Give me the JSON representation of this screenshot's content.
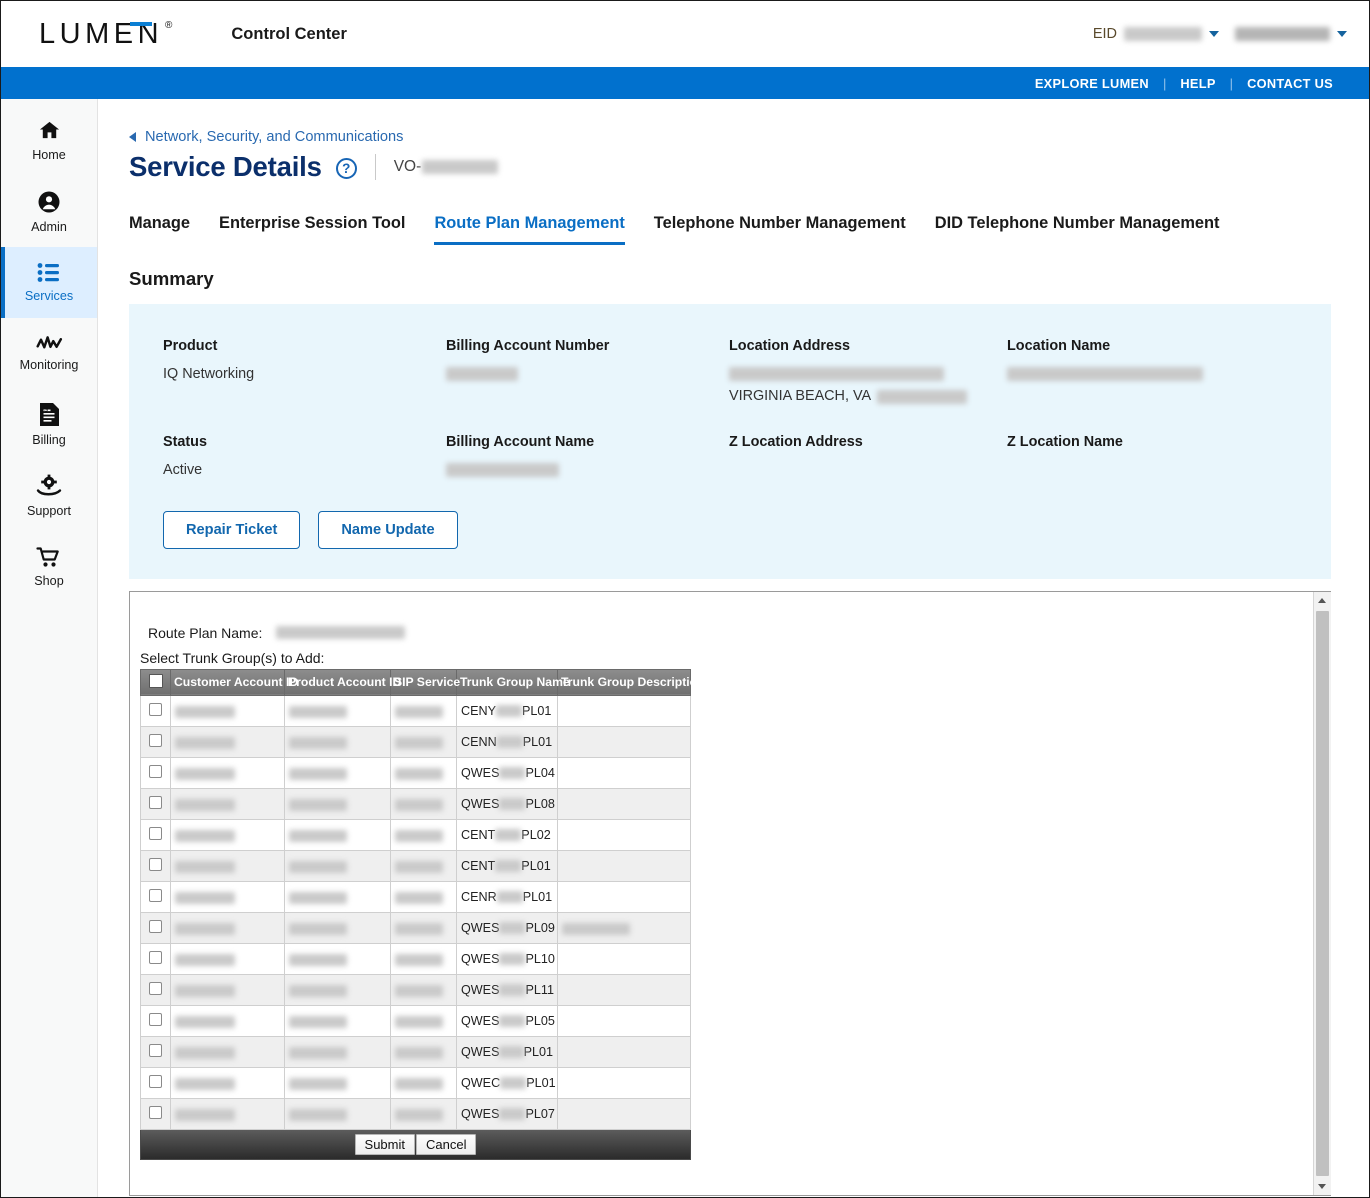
{
  "header": {
    "brand": "LUMEN",
    "brand_registered": "®",
    "app_title": "Control Center",
    "eid_label": "EID",
    "eid_value": "1111762722",
    "account_name": "thatfinancialdd"
  },
  "bluebar": {
    "explore": "EXPLORE LUMEN",
    "help": "HELP",
    "contact": "CONTACT US",
    "separator": "|"
  },
  "sidebar": {
    "items": [
      {
        "label": "Home",
        "icon": "home-icon",
        "active": false
      },
      {
        "label": "Admin",
        "icon": "user-circle-icon",
        "active": false
      },
      {
        "label": "Services",
        "icon": "list-icon",
        "active": true
      },
      {
        "label": "Monitoring",
        "icon": "activity-icon",
        "active": false
      },
      {
        "label": "Billing",
        "icon": "invoice-icon",
        "active": false
      },
      {
        "label": "Support",
        "icon": "support-gear-hand-icon",
        "active": false
      },
      {
        "label": "Shop",
        "icon": "cart-icon",
        "active": false
      }
    ]
  },
  "breadcrumb": {
    "label": "Network, Security, and Communications",
    "back_icon": "chevron-left-icon"
  },
  "page": {
    "title": "Service Details",
    "help_icon": "question-mark-icon",
    "service_id_prefix": "VO-",
    "service_id_value": "1002275aa"
  },
  "tabs": [
    {
      "label": "Manage",
      "active": false
    },
    {
      "label": "Enterprise Session Tool",
      "active": false
    },
    {
      "label": "Route Plan Management",
      "active": true
    },
    {
      "label": "Telephone Number Management",
      "active": false
    },
    {
      "label": "DID Telephone Number Management",
      "active": false
    }
  ],
  "summary": {
    "heading": "Summary",
    "fields": [
      {
        "label": "Product",
        "value": "IQ Networking",
        "redacted": false
      },
      {
        "label": "Billing Account Number",
        "value": "78362024",
        "redacted": true
      },
      {
        "label": "Location Address",
        "value_line1": "222 CENTRAL PARK AVE, FLR 16,",
        "value_line2_visible": "VIRGINIA BEACH, VA",
        "value_line2_redacted": "23462, USA",
        "redacted": true
      },
      {
        "label": "Location Name",
        "value": "VIRGINIA BEACH - NORFOLK",
        "redacted": true
      },
      {
        "label": "Status",
        "value": "Active",
        "redacted": false
      },
      {
        "label": "Billing Account Name",
        "value": "APEX SYSTEMS",
        "redacted": true
      },
      {
        "label": "Z Location Address",
        "value": "",
        "redacted": false
      },
      {
        "label": "Z Location Name",
        "value": "",
        "redacted": false
      }
    ],
    "buttons": [
      {
        "label": "Repair Ticket"
      },
      {
        "label": "Name Update"
      }
    ]
  },
  "route_plan": {
    "name_label": "Route Plan Name:",
    "name_value": "TRTE_QVHDWNUPL01",
    "select_label": "Select Trunk Group(s) to Add:",
    "columns": [
      "",
      "Customer Account ID",
      "Product Account ID",
      "SIP Service",
      "Trunk Group Name",
      "Trunk Group Description"
    ],
    "rows": [
      {
        "customer_account_id": "78768241",
        "product_account_id": "NNXB7771",
        "sip_service": "838867G2",
        "tg_prefix": "CENY",
        "tg_mid": "4411",
        "tg_suffix": "PL01",
        "description": ""
      },
      {
        "customer_account_id": "78768241",
        "product_account_id": "NNXB7774",
        "sip_service": "838867G2",
        "tg_prefix": "CENN",
        "tg_mid": "5520",
        "tg_suffix": "PL01",
        "description": ""
      },
      {
        "customer_account_id": "78768241",
        "product_account_id": "NQXH5382",
        "sip_service": "838867G2",
        "tg_prefix": "QWES",
        "tg_mid": "1146",
        "tg_suffix": "PL04",
        "description": ""
      },
      {
        "customer_account_id": "78768241",
        "product_account_id": "NQXH5386",
        "sip_service": "838867G2",
        "tg_prefix": "QWES",
        "tg_mid": "1146",
        "tg_suffix": "PL08",
        "description": ""
      },
      {
        "customer_account_id": "78768241",
        "product_account_id": "LNNB6827",
        "sip_service": "838867G2",
        "tg_prefix": "CENT",
        "tg_mid": "221",
        "tg_suffix": "PL02",
        "description": ""
      },
      {
        "customer_account_id": "78768241",
        "product_account_id": "NGYAHT38",
        "sip_service": "838867G2",
        "tg_prefix": "CENT",
        "tg_mid": "4401",
        "tg_suffix": "PL01",
        "description": ""
      },
      {
        "customer_account_id": "78768241",
        "product_account_id": "NNXB7773",
        "sip_service": "838867G2",
        "tg_prefix": "CENR",
        "tg_mid": "2213",
        "tg_suffix": "PL01",
        "description": ""
      },
      {
        "customer_account_id": "78768241",
        "product_account_id": "NQXH5388",
        "sip_service": "838867G2",
        "tg_prefix": "QWES",
        "tg_mid": "1146",
        "tg_suffix": "PL09",
        "description": "columbus oh"
      },
      {
        "customer_account_id": "78768241",
        "product_account_id": "NQXH5387",
        "sip_service": "838867G2",
        "tg_prefix": "QWES",
        "tg_mid": "1146",
        "tg_suffix": "PL10",
        "description": ""
      },
      {
        "customer_account_id": "78768241",
        "product_account_id": "LNXB2091",
        "sip_service": "838867G2",
        "tg_prefix": "QWES",
        "tg_mid": "1146",
        "tg_suffix": "PL11",
        "description": ""
      },
      {
        "customer_account_id": "78768241",
        "product_account_id": "NQXH5275",
        "sip_service": "838867G2",
        "tg_prefix": "QWES",
        "tg_mid": "1146",
        "tg_suffix": "PL05",
        "description": ""
      },
      {
        "customer_account_id": "78768241",
        "product_account_id": "LNXB8481",
        "sip_service": "838867G2",
        "tg_prefix": "QWES",
        "tg_mid": "114",
        "tg_suffix": "PL01",
        "description": ""
      },
      {
        "customer_account_id": "78768241",
        "product_account_id": "LNXB8481",
        "sip_service": "838867G2",
        "tg_prefix": "QWEC",
        "tg_mid": "1146",
        "tg_suffix": "PL01",
        "description": ""
      },
      {
        "customer_account_id": "78768241",
        "product_account_id": "NQXH5273",
        "sip_service": "838867G2",
        "tg_prefix": "QWES",
        "tg_mid": "1146",
        "tg_suffix": "PL07",
        "description": ""
      }
    ],
    "footer_buttons": [
      {
        "label": "Submit"
      },
      {
        "label": "Cancel"
      }
    ]
  },
  "colors": {
    "brand_blue": "#0171ce",
    "accent_blue": "#0a6ec4",
    "title_navy": "#0b2f6b",
    "summary_bg": "#e9f6fc",
    "sidebar_active_bg": "#ddeeff"
  }
}
